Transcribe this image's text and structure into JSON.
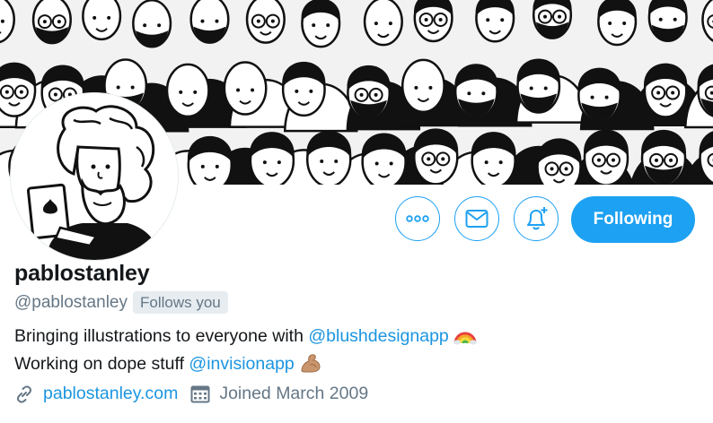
{
  "profile": {
    "display_name": "pablostanley",
    "handle": "@pablostanley",
    "follows_you_label": "Follows you",
    "bio_line1_text": "Bringing illustrations to everyone with ",
    "bio_line1_mention": "@blushdesignapp",
    "bio_line2_text": "Working on dope stuff ",
    "bio_line2_mention": "@invisionapp",
    "website": "pablostanley.com",
    "joined": "Joined March 2009"
  },
  "actions": {
    "follow_label": "Following"
  },
  "icons": {
    "more": "more-options-icon",
    "message": "envelope-icon",
    "notify": "bell-plus-icon",
    "link": "link-icon",
    "calendar": "calendar-icon",
    "rainbow": "rainbow-emoji",
    "muscle": "flexed-biceps-emoji"
  },
  "colors": {
    "accent": "#1da1f2",
    "link": "#1b95e0",
    "secondary_text": "#657786",
    "badge_bg": "#e6ecf0"
  }
}
